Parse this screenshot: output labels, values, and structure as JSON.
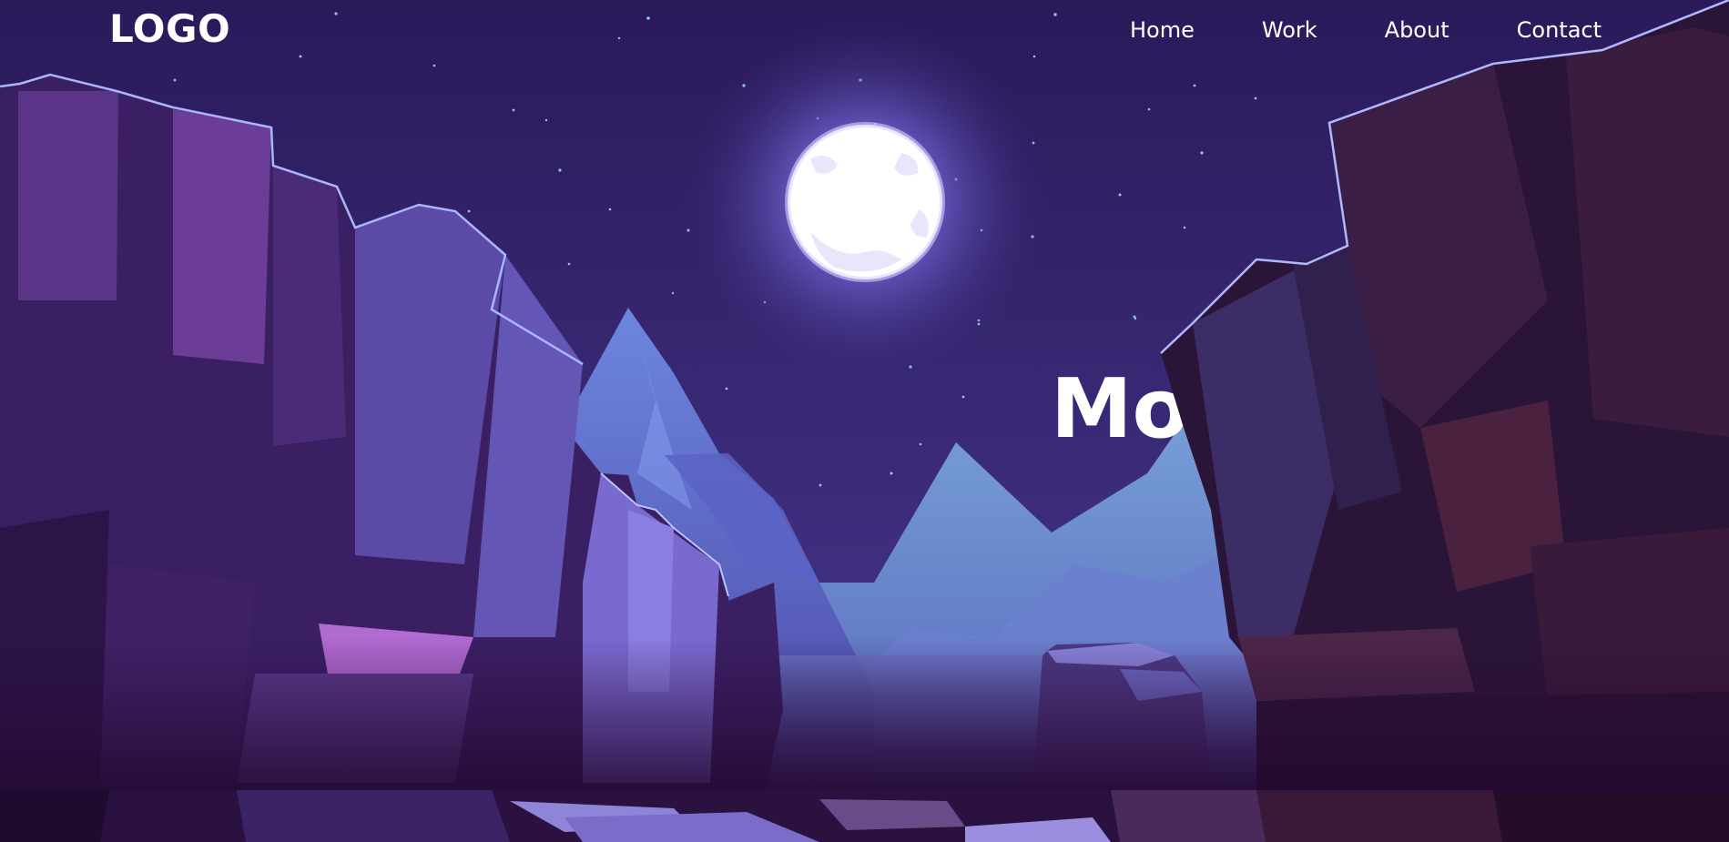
{
  "header": {
    "logo": "LOGO",
    "nav": [
      {
        "label": "Home"
      },
      {
        "label": "Work"
      },
      {
        "label": "About"
      },
      {
        "label": "Contact"
      }
    ]
  },
  "hero": {
    "title_visible": "Mo"
  },
  "colors": {
    "sky_top": "#2c1a5a",
    "sky_mid": "#3b2a78",
    "moon": "#ffffff",
    "moon_glow": "#8a7ff0",
    "far_mountain": "#6c8fd0",
    "mid_mountain": "#6b73d6",
    "cliff_left": "#4b2a78",
    "cliff_right": "#2b1a40",
    "text": "#ffffff"
  },
  "icons": {
    "moon": "full-moon-icon"
  }
}
